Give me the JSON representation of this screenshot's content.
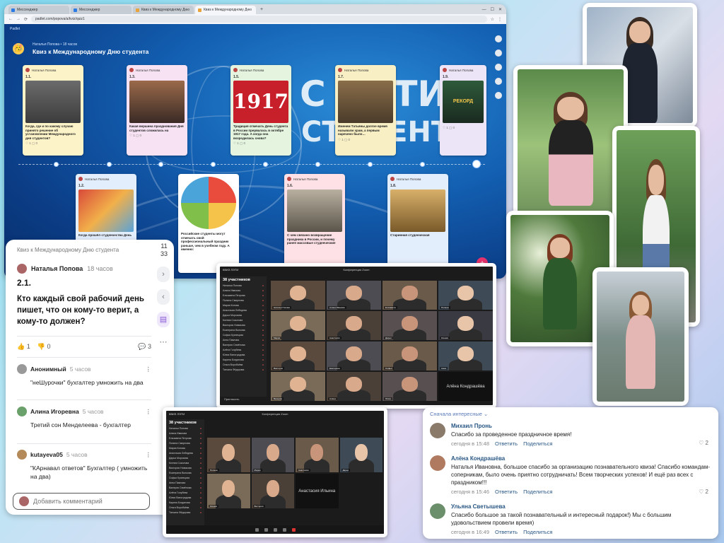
{
  "browser": {
    "tabs": [
      "Мессенджер",
      "Мессенджер",
      "Квиз к Международному Дню",
      "Квиз к Международному Дню"
    ],
    "url": "padlet.com/popova/a/kviz/quiz1",
    "padlet_brand": "Padlet",
    "owner_line": "Наталья Попова • 18 часов",
    "title": "Квиз к Международному Дню студента",
    "bg_words": [
      "С ЛЭТИ",
      "СТУДЕНТА"
    ],
    "posts": [
      {
        "author": "Наталья Попова",
        "num": "1.1.",
        "caption": "Когда, где и по какому случаю принято решение об установлении Международного дня студентов?",
        "color": "#fdf3c8"
      },
      {
        "author": "Наталья Попова",
        "num": "1.3.",
        "caption": "Какая вершина празднования Дня студентов сложилась на",
        "color": "#f7e2f3"
      },
      {
        "author": "Наталья Попова",
        "num": "1.5.",
        "caption": "Традиция отмечать День студента в России прервалась в октябре 1917 года. А когда она возродилась снова?",
        "color": "#e4f4df"
      },
      {
        "author": "Наталья Попова",
        "num": "1.7.",
        "caption": "Именем Татьяны долгое время называли храм, а первым наречено было…",
        "color": "#f8efc4"
      },
      {
        "author": "Наталья Попова",
        "num": "1.9.",
        "caption": "РЕКОРД",
        "color": "#ece5f7"
      },
      {
        "author": "Наталья Попова",
        "num": "1.2.",
        "caption": "Когда прошёл студенчества День",
        "color": "#e3eefc"
      },
      {
        "author": "",
        "num": "",
        "caption": "Российские студенты могут отмечать свой профессиональный праздник раньше, чем в учебном году. А именно:",
        "color": "#ffffff"
      },
      {
        "author": "Наталья Попова",
        "num": "1.6.",
        "caption": "С чем связано возвращение праздника в России, и почему ранее массовые студенческие",
        "color": "#fde1e6"
      },
      {
        "author": "Наталья Попова",
        "num": "1.8.",
        "caption": "Старинная студенческая",
        "color": "#e3eefc"
      }
    ]
  },
  "comments_panel": {
    "header": "Квиз к Международному Дню студента",
    "count_top": "11",
    "count_bottom": "33",
    "author": "Наталья Попова",
    "author_time": "18 часов",
    "number": "2.1.",
    "question": "Кто каждый свой рабочий день пишет, что он кому-то верит, а кому-то должен?",
    "likes": "1",
    "dislikes": "0",
    "comments_count": "3",
    "comments": [
      {
        "name": "Анонимный",
        "time": "5 часов",
        "text": "\"неШурочки\" бухгалтер умножить на два",
        "color": "#999"
      },
      {
        "name": "Алина Игоревна",
        "time": "5 часов",
        "text": "Третий сон Менделеева - бухгалтер",
        "color": "#6aa06a"
      },
      {
        "name": "kutayeva05",
        "time": "5 часов",
        "text": "\"КАрнавал ответов\" Бухгалтер ( умножить на два)",
        "color": "#b48a5a"
      }
    ],
    "input_placeholder": "Добавить комментарий"
  },
  "zoom_big": {
    "app": "КВИЗ ЛЭТИ",
    "title": "Конференция Zoom",
    "participants_header": "38 участников",
    "participants": [
      "Наталья Попова",
      "Алина Иванова",
      "Елизавета Петрова",
      "Полина Смирнова",
      "Мария Котова",
      "Анастасия Лебедева",
      "Дарья Морозова",
      "Ксения Соколова",
      "Виктория Новикова",
      "Екатерина Волкова",
      "Софья Кузнецова",
      "Анна Павлова",
      "Валерия Семёнова",
      "Алёна Голубева",
      "Юлия Виноградова",
      "Карина Богданова",
      "Ольга Воробьёва",
      "Татьяна Фёдорова"
    ],
    "invite": "Пригласить",
    "tiles": [
      "Наталья Попова",
      "Алина Иванова",
      "Елизавета",
      "Полина",
      "Мария",
      "Анастасия",
      "Дарья",
      "Ксения",
      "Виктория",
      "Екатерина",
      "Софья",
      "Анна",
      "Валерия",
      "Алёна",
      "Юлия"
    ],
    "text_tile": "Алёна Кондрашёва"
  },
  "zoom_small": {
    "app": "КВИЗ ЛЭТИ",
    "title": "Конференция Zoom",
    "participants_header": "38 участников",
    "participants": [
      "Наталья Попова",
      "Алина Иванова",
      "Елизавета Петрова",
      "Полина Смирнова",
      "Мария Котова",
      "Анастасия Лебедева",
      "Дарья Морозова",
      "Ксения Соколова",
      "Виктория Новикова",
      "Екатерина Волкова",
      "Софья Кузнецова",
      "Анна Павлова",
      "Валерия Семёнова",
      "Алёна Голубева",
      "Юлия Виноградова",
      "Карина Богданова",
      "Ольга Воробьёва",
      "Татьяна Фёдорова"
    ],
    "tiles": [
      "Полина",
      "Мария",
      "Анастасия",
      "Дарья",
      "Ксения",
      "Виктория"
    ],
    "text_tile": "Анастасия Ильина"
  },
  "vk": {
    "sort_label": "Сначала интересные",
    "comments": [
      {
        "name": "Михаил Пронь",
        "text": "Спасибо за проведенное праздничное время!",
        "time": "сегодня в 15:48",
        "reply": "Ответить",
        "share": "Поделиться",
        "likes": "2",
        "color": "#8a7a6a"
      },
      {
        "name": "Алёна Кондрашёва",
        "text": "Наталья Ивановна, большое спасибо за организацию познавательного квиза! Спасибо командам-соперникам, было очень приятно сотрудничать! Всем творческих успехов! И ещё раз всех с праздником!!!",
        "time": "сегодня в 15:46",
        "reply": "Ответить",
        "share": "Поделиться",
        "likes": "2",
        "color": "#b07a60"
      },
      {
        "name": "Ульяна Светышева",
        "text": "Спасибо большое за такой познавательный и интересный подарок!) Мы с большим удовольствием провели время)",
        "time": "сегодня в 16:49",
        "reply": "Ответить",
        "share": "Поделиться",
        "likes": "",
        "color": "#6a8f6a"
      }
    ]
  },
  "colors": {
    "padlet_bg": "#135fb1",
    "accent_pink": "#e8336d",
    "vk_link": "#2a5885"
  }
}
